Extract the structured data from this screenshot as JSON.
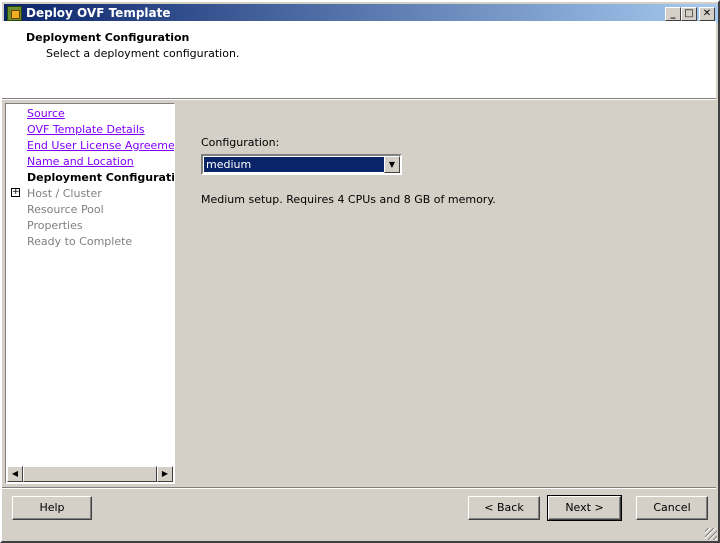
{
  "window": {
    "title": "Deploy OVF Template",
    "controls": {
      "minimize": "_",
      "maximize": "□",
      "close": "✕"
    }
  },
  "header": {
    "title": "Deployment Configuration",
    "subtitle": "Select a deployment configuration."
  },
  "nav": {
    "items": [
      {
        "label": "Source",
        "state": "visited"
      },
      {
        "label": "OVF Template Details",
        "state": "visited"
      },
      {
        "label": "End User License Agreement",
        "state": "visited"
      },
      {
        "label": "Name and Location",
        "state": "visited"
      },
      {
        "label": "Deployment Configuration",
        "state": "current"
      },
      {
        "label": "Host / Cluster",
        "state": "disabled",
        "expandable": true
      },
      {
        "label": "Resource Pool",
        "state": "disabled"
      },
      {
        "label": "Properties",
        "state": "disabled"
      },
      {
        "label": "Ready to Complete",
        "state": "disabled"
      }
    ]
  },
  "main": {
    "config_label": "Configuration:",
    "config_value": "medium",
    "description": "Medium setup. Requires 4 CPUs and 8 GB of memory."
  },
  "buttons": {
    "help": "Help",
    "back": "< Back",
    "next": "Next >",
    "cancel": "Cancel"
  }
}
